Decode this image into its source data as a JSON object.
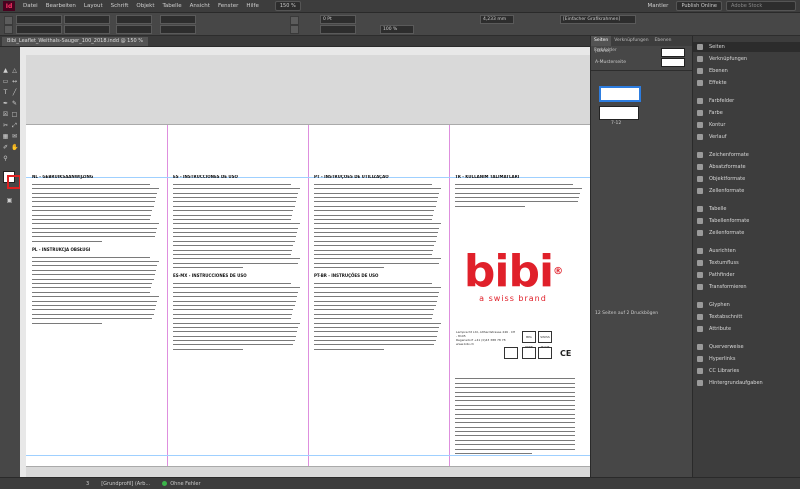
{
  "app": {
    "logo": "Id",
    "menus": [
      "Datei",
      "Bearbeiten",
      "Layout",
      "Schrift",
      "Objekt",
      "Tabelle",
      "Ansicht",
      "Fenster",
      "Hilfe"
    ],
    "zoom": "150 %",
    "user": "Mantler",
    "publish_button": "Publish Online",
    "search_placeholder": "Adobe Stock"
  },
  "control": {
    "stroke_weight": "0 Pt",
    "percent": "100 %",
    "measure": "4,233 mm",
    "frame_style": "[Einfacher Grafikrahmen]"
  },
  "document": {
    "tab_label": "Bibi_Leaflet_Weithals-Sauger_100_2018.indd @ 150 %"
  },
  "columns": [
    {
      "blocks": [
        {
          "head": "NL - GEBRUIKSAANWIJZING",
          "lines": 14
        },
        {
          "head": "PL - INSTRUKCJA OBSŁUGI",
          "lines": 16
        }
      ]
    },
    {
      "blocks": [
        {
          "head": "ES - INSTRUCCIONES DE USO",
          "lines": 20
        },
        {
          "head": "ES-MX - INSTRUCCIONES DE USO",
          "lines": 16
        }
      ]
    },
    {
      "blocks": [
        {
          "head": "PT - INSTRUÇÕES DE UTILIZAÇÃO",
          "lines": 20
        },
        {
          "head": "PT-BR - INSTRUÇÕES DE USO",
          "lines": 16
        }
      ]
    },
    {
      "blocks": [
        {
          "head": "TR - KULLANIM TALIMATLARI",
          "lines": 6
        }
      ]
    }
  ],
  "brand": {
    "word": "bibi",
    "registered": "®",
    "tagline": "a swiss brand",
    "address_lines": [
      "Lamprecht Ltd, Althardstrasse 246 · CH - 8105",
      "Regensdorf +41 (0)43 388 78 78 www.bibi.ch",
      "BPA FREE",
      "SWISS MADE"
    ],
    "ce_mark": "CE"
  },
  "pages_panel": {
    "tabs": [
      "Seiten",
      "Verknüpfungen",
      "Ebenen",
      "Farbfelder"
    ],
    "master_none": "[Ohne]",
    "master_a": "A-Musterseite",
    "page_label": "7-12",
    "footer": "12 Seiten auf 2 Druckbögen"
  },
  "side_panels": [
    "Seiten",
    "Verknüpfungen",
    "Ebenen",
    "Effekte",
    "Farbfelder",
    "Farbe",
    "Kontur",
    "Verlauf",
    "Zeichenformate",
    "Absatzformate",
    "Objektformate",
    "Zellenformate",
    "Tabelle",
    "Tabellenformate",
    "Zeilenformate",
    "Ausrichten",
    "Textumfluss",
    "Pathfinder",
    "Transformieren",
    "Glyphen",
    "Textabschnitt",
    "Attribute",
    "Querverweise",
    "Hyperlinks",
    "CC Libraries",
    "Hintergrundaufgaben"
  ],
  "status": {
    "page": "3",
    "master": "[Grundprofil] (Arb...",
    "errors": "Ohne Fehler"
  }
}
